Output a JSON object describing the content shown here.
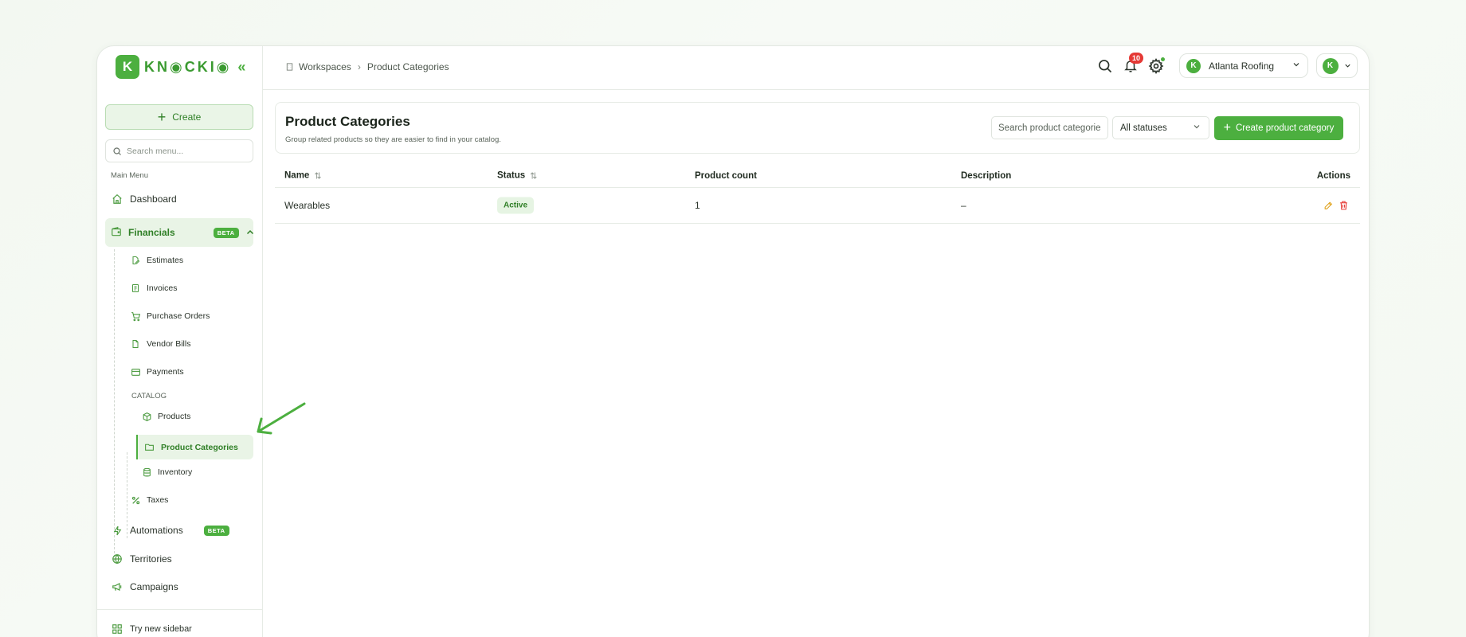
{
  "brand": {
    "logo_letter": "K",
    "logo_text": "KN◉CKI◉",
    "collapse_glyph": "«"
  },
  "sidebar": {
    "create_label": "Create",
    "search_placeholder": "Search menu...",
    "main_menu_label": "Main Menu",
    "dashboard": "Dashboard",
    "financials": {
      "label": "Financials",
      "badge": "BETA"
    },
    "financial_items": [
      "Estimates",
      "Invoices",
      "Purchase Orders",
      "Vendor Bills",
      "Payments"
    ],
    "catalog_label": "CATALOG",
    "catalog_items": [
      "Products",
      "Product Categories",
      "Inventory"
    ],
    "taxes": "Taxes",
    "automations": {
      "label": "Automations",
      "badge": "BETA"
    },
    "territories": "Territories",
    "campaigns": "Campaigns",
    "try_new_sidebar": "Try new sidebar"
  },
  "header": {
    "breadcrumb": [
      "Workspaces",
      "Product Categories"
    ],
    "notification_count": "10",
    "workspace_letter": "K",
    "workspace_name": "Atlanta Roofing",
    "user_letter": "K"
  },
  "page": {
    "title": "Product Categories",
    "subtitle": "Group related products so they are easier to find in your catalog.",
    "search_placeholder": "Search product categories",
    "status_filter": "All statuses",
    "create_button": "Create product category"
  },
  "table": {
    "columns": {
      "name": "Name",
      "status": "Status",
      "product_count": "Product count",
      "description": "Description",
      "actions": "Actions"
    },
    "rows": [
      {
        "name": "Wearables",
        "status": "Active",
        "product_count": "1",
        "description": "–"
      }
    ]
  },
  "colors": {
    "accent": "#4caf3f",
    "accent_light": "#e9f4e6",
    "danger": "#e53935",
    "edit": "#e0a21b"
  }
}
